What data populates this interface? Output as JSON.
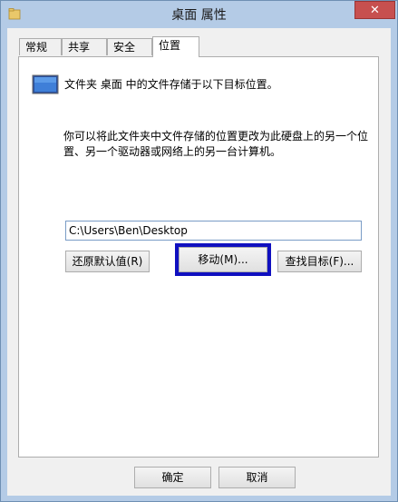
{
  "window": {
    "title": "桌面 属性",
    "close_glyph": "✕"
  },
  "tabs": [
    {
      "label": "常规"
    },
    {
      "label": "共享"
    },
    {
      "label": "安全"
    },
    {
      "label": "位置",
      "active": true
    }
  ],
  "location": {
    "description": "文件夹 桌面 中的文件存储于以下目标位置。",
    "paragraph": "你可以将此文件夹中文件存储的位置更改为此硬盘上的另一个位置、另一个驱动器或网络上的另一台计算机。",
    "path_value": "C:\\Users\\Ben\\Desktop",
    "restore_default_label": "还原默认值(R)",
    "move_label": "移动(M)...",
    "find_target_label": "查找目标(F)..."
  },
  "footer": {
    "ok_label": "确定",
    "cancel_label": "取消"
  },
  "colors": {
    "focus_ring": "#1010c0",
    "close_button": "#c7504f"
  }
}
